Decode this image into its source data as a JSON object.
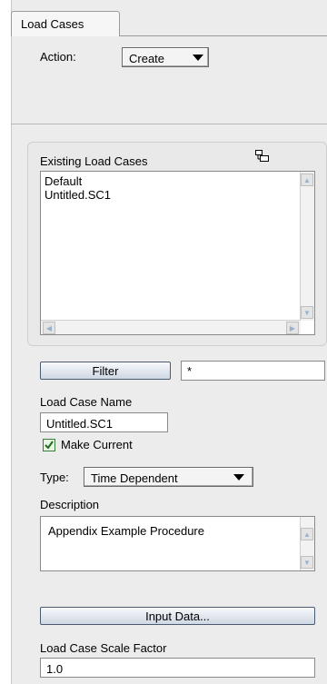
{
  "tab": {
    "label": "Load Cases"
  },
  "action": {
    "label": "Action:",
    "value": "Create"
  },
  "existing": {
    "label": "Existing Load Cases",
    "items": [
      "Default",
      "Untitled.SC1"
    ]
  },
  "filter": {
    "button_label": "Filter",
    "value": "*"
  },
  "load_case_name": {
    "label": "Load Case Name",
    "value": "Untitled.SC1"
  },
  "make_current": {
    "label": "Make Current",
    "checked": true
  },
  "type": {
    "label": "Type:",
    "value": "Time Dependent"
  },
  "description": {
    "label": "Description",
    "value": "Appendix Example Procedure"
  },
  "input_data": {
    "button_label": "Input Data..."
  },
  "scale_factor": {
    "label": "Load Case Scale Factor",
    "value": "1.0"
  },
  "icons": {
    "dropdown": "chevron-down-icon",
    "list_options": "tree-view-icon",
    "check": "checkmark-icon",
    "scroll_up": "arrow-up-icon",
    "scroll_down": "arrow-down-icon",
    "scroll_left": "arrow-left-icon",
    "scroll_right": "arrow-right-icon"
  },
  "colors": {
    "panel": "#ececec",
    "button_border": "#4a5a70",
    "checkbox": "#3a7a3a"
  }
}
